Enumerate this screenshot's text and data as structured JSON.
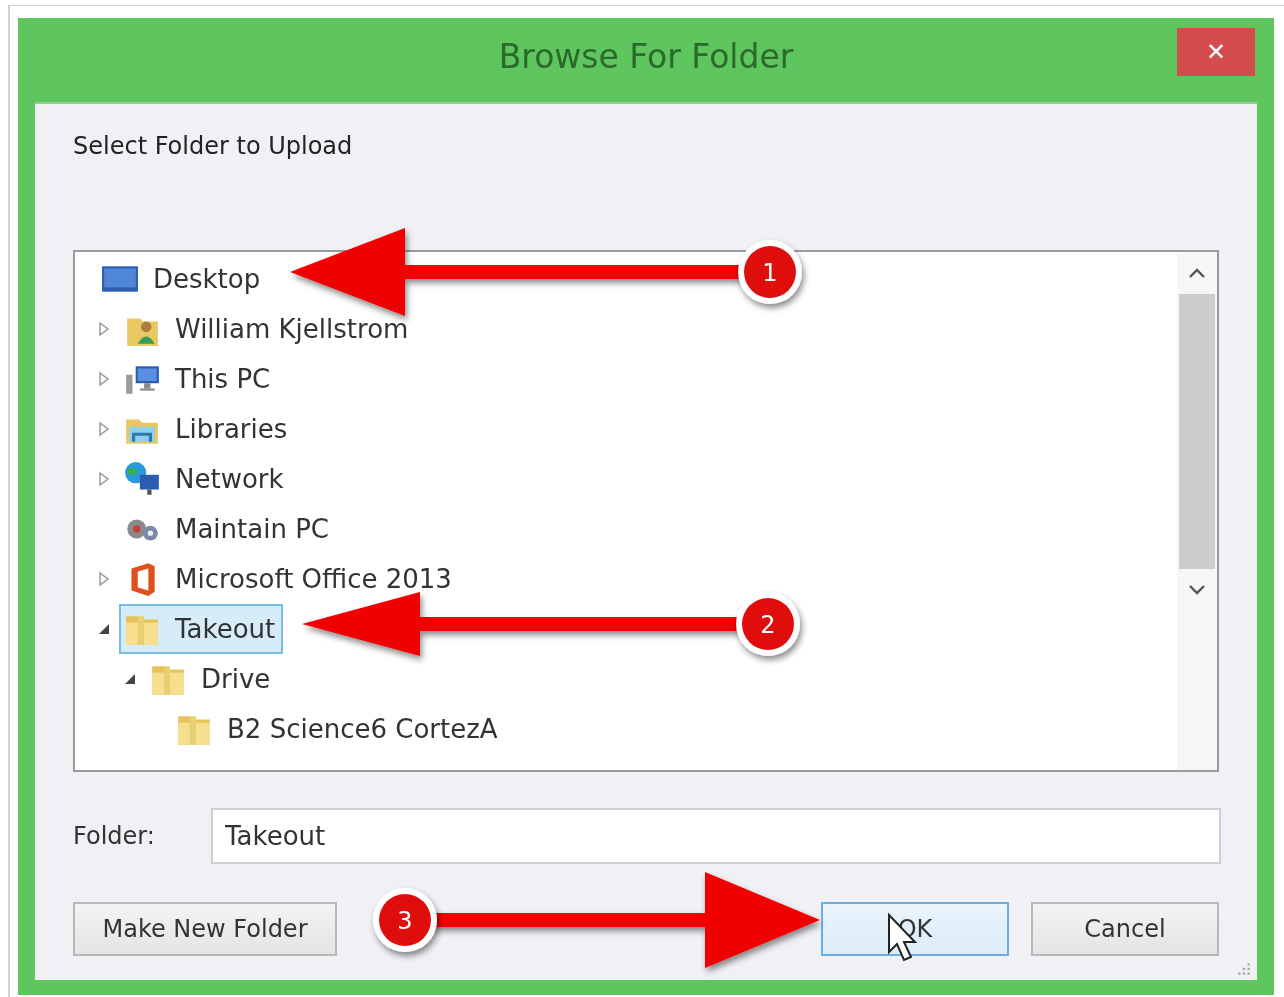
{
  "window": {
    "title": "Browse For Folder",
    "close": "✕"
  },
  "prompt": "Select Folder to Upload",
  "tree": [
    {
      "label": "Desktop",
      "kind": "desktop",
      "selected": false
    },
    {
      "label": "William Kjellstrom",
      "kind": "user",
      "expanded": false,
      "selected": false
    },
    {
      "label": "This PC",
      "kind": "pc",
      "expanded": false,
      "selected": false
    },
    {
      "label": "Libraries",
      "kind": "libraries",
      "expanded": false,
      "selected": false
    },
    {
      "label": "Network",
      "kind": "network",
      "expanded": false,
      "selected": false
    },
    {
      "label": "Maintain PC",
      "kind": "maintenance",
      "selected": false
    },
    {
      "label": "Microsoft Office 2013",
      "kind": "office",
      "expanded": false,
      "selected": false
    },
    {
      "label": "Takeout",
      "kind": "folder",
      "expanded": true,
      "selected": true,
      "children": [
        {
          "label": "Drive",
          "kind": "folder",
          "expanded": true,
          "selected": false,
          "children": [
            {
              "label": "B2 Science6 CortezA",
              "kind": "folder",
              "selected": false
            }
          ]
        }
      ]
    }
  ],
  "folder_field": {
    "label": "Folder:",
    "value": "Takeout"
  },
  "buttons": [
    {
      "label": "Make New Folder",
      "focused": false
    },
    {
      "label": "OK",
      "focused": true
    },
    {
      "label": "Cancel",
      "focused": false
    }
  ],
  "annotations": [
    {
      "number": "1"
    },
    {
      "number": "2"
    },
    {
      "number": "3"
    }
  ]
}
